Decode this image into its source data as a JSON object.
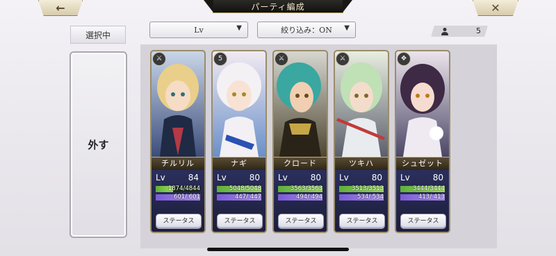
{
  "header": {
    "title": "パーティ編成",
    "back_icon": "arrow-left",
    "close_icon": "x"
  },
  "filters": {
    "selected_label": "選択中",
    "sort_value": "Lv",
    "filter_value": "絞り込み：ON",
    "party_count": "5"
  },
  "remove_button": {
    "label": "外す"
  },
  "characters": [
    {
      "name": "チルリル",
      "lv_label": "Lv",
      "lv": "84",
      "hp": "1874/4844",
      "hp_ratio": 0.387,
      "mp": "601/ 601",
      "mp_ratio": 1.0,
      "status_label": "ステータス",
      "type_icon": "sword"
    },
    {
      "name": "ナギ",
      "lv_label": "Lv",
      "lv": "80",
      "hp": "5048/5048",
      "hp_ratio": 1.0,
      "mp": "447/ 447",
      "mp_ratio": 1.0,
      "status_label": "ステータス",
      "type_icon": "5"
    },
    {
      "name": "クロード",
      "lv_label": "Lv",
      "lv": "80",
      "hp": "3563/3563",
      "hp_ratio": 1.0,
      "mp": "494/ 494",
      "mp_ratio": 1.0,
      "status_label": "ステータス",
      "type_icon": "sword"
    },
    {
      "name": "ツキハ",
      "lv_label": "Lv",
      "lv": "80",
      "hp": "3513/3513",
      "hp_ratio": 1.0,
      "mp": "534/ 534",
      "mp_ratio": 1.0,
      "status_label": "ステータス",
      "type_icon": "sword"
    },
    {
      "name": "シュゼット",
      "lv_label": "Lv",
      "lv": "80",
      "hp": "3444/3444",
      "hp_ratio": 1.0,
      "mp": "413/ 413",
      "mp_ratio": 1.0,
      "status_label": "ステータス",
      "type_icon": "staff"
    }
  ],
  "colors": {
    "hp": "#7bc84a",
    "mp": "#8c6fe3",
    "card_border": "#9a8d6a"
  }
}
